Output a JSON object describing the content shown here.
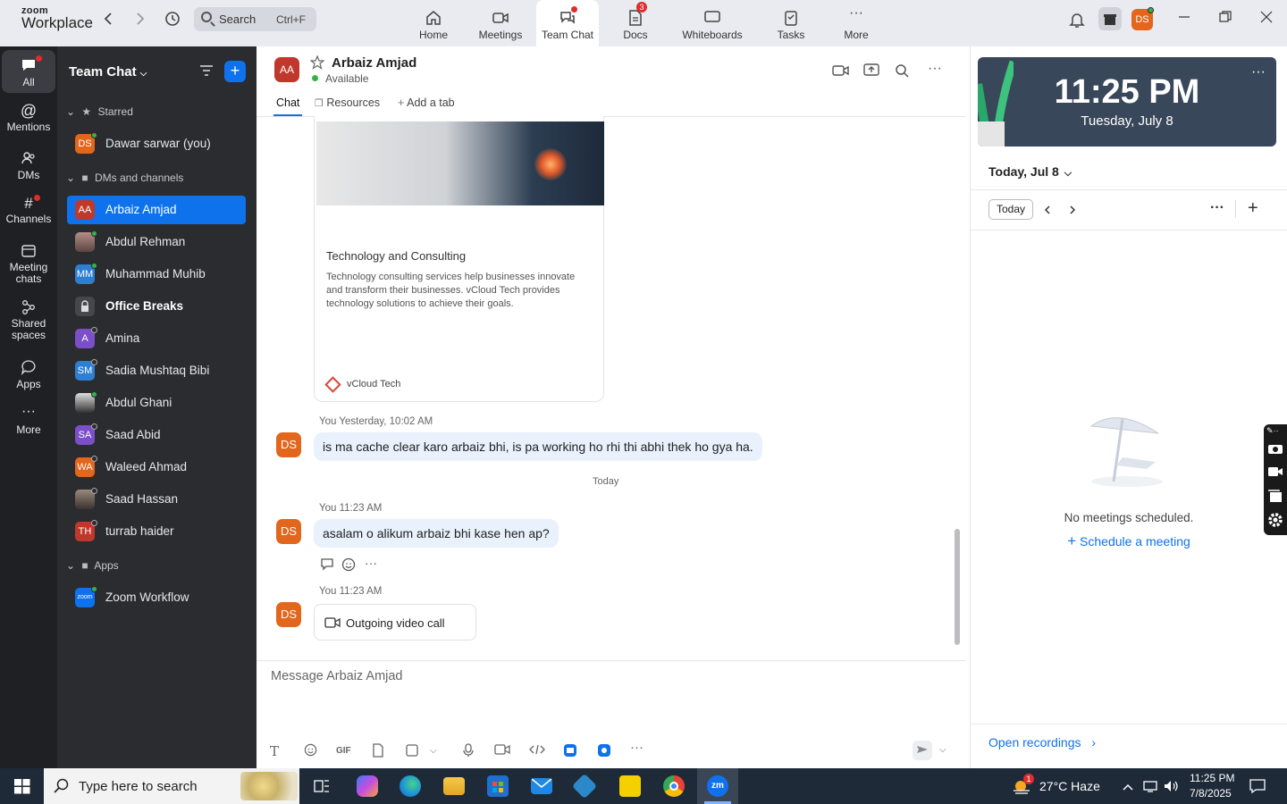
{
  "app": {
    "brand_small": "zoom",
    "brand_big": "Workplace"
  },
  "search": {
    "label": "Search",
    "shortcut": "Ctrl+F"
  },
  "nav_tabs": [
    {
      "label": "Home"
    },
    {
      "label": "Meetings"
    },
    {
      "label": "Team Chat"
    },
    {
      "label": "Docs",
      "badge": "3"
    },
    {
      "label": "Whiteboards"
    },
    {
      "label": "Tasks"
    },
    {
      "label": "More"
    }
  ],
  "profile_initials": "DS",
  "rail": [
    {
      "label": "All"
    },
    {
      "label": "Mentions"
    },
    {
      "label": "DMs"
    },
    {
      "label": "Channels"
    },
    {
      "label": "Meeting chats"
    },
    {
      "label": "Shared spaces"
    },
    {
      "label": "Apps"
    },
    {
      "label": "More"
    }
  ],
  "side": {
    "title": "Team Chat",
    "starred_label": "Starred",
    "dms_label": "DMs and channels",
    "apps_label": "Apps",
    "starred": [
      {
        "initials": "DS",
        "name": "Dawar sarwar (you)"
      }
    ],
    "dms": [
      {
        "initials": "AA",
        "name": "Arbaiz Amjad"
      },
      {
        "initials": "",
        "name": "Abdul Rehman"
      },
      {
        "initials": "MM",
        "name": "Muhammad Muhib"
      },
      {
        "initials": "",
        "name": "Office Breaks"
      },
      {
        "initials": "A",
        "name": "Amina"
      },
      {
        "initials": "SM",
        "name": "Sadia Mushtaq Bibi"
      },
      {
        "initials": "",
        "name": "Abdul Ghani"
      },
      {
        "initials": "SA",
        "name": "Saad Abid"
      },
      {
        "initials": "WA",
        "name": "Waleed Ahmad"
      },
      {
        "initials": "",
        "name": "Saad Hassan"
      },
      {
        "initials": "TH",
        "name": "turrab haider"
      }
    ],
    "apps": [
      {
        "initials": "zoom",
        "name": "Zoom Workflow"
      }
    ]
  },
  "chat": {
    "contact_initials": "AA",
    "contact_name": "Arbaiz Amjad",
    "status": "Available",
    "tabs": {
      "chat": "Chat",
      "resources": "Resources",
      "add": "Add a tab"
    },
    "card": {
      "title": "Technology and Consulting",
      "desc": "Technology consulting services help businesses innovate and transform their businesses. vCloud Tech provides technology solutions to achieve their goals.",
      "source": "vCloud Tech"
    },
    "messages": [
      {
        "initials": "DS",
        "meta": "You Yesterday, 10:02 AM",
        "text": "is ma cache clear karo arbaiz bhi, is pa working ho rhi thi abhi thek ho gya ha."
      },
      {
        "initials": "DS",
        "meta": "You 11:23 AM",
        "text": "asalam o alikum arbaiz bhi kase hen ap?"
      },
      {
        "initials": "DS",
        "meta": "You 11:23 AM",
        "text": "Outgoing video call"
      }
    ],
    "day_separator": "Today",
    "composer_placeholder": "Message Arbaiz Amjad",
    "gif_label": "GIF"
  },
  "calendar": {
    "time": "11:25 PM",
    "date": "Tuesday, July 8",
    "heading": "Today, Jul 8",
    "today_button": "Today",
    "empty_text": "No meetings scheduled.",
    "schedule_link": "Schedule a meeting",
    "open_recordings": "Open recordings"
  },
  "taskbar": {
    "search_placeholder": "Type here to search",
    "weather": "27°C  Haze",
    "weather_badge": "1",
    "clock_time": "11:25 PM",
    "clock_date": "7/8/2025",
    "zoom_label": "zm"
  }
}
